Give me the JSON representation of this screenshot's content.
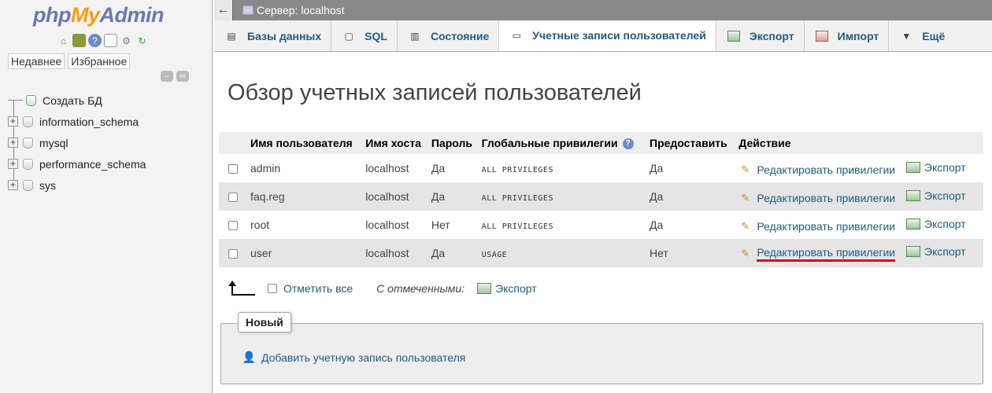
{
  "nav": {
    "logo_php": "php",
    "logo_my": "My",
    "logo_admin": "Admin",
    "icons": [
      "home-icon",
      "db-icon",
      "help-icon",
      "docs-icon",
      "settings-icon",
      "reload-icon"
    ],
    "tabs": [
      "Недавнее",
      "Избранное"
    ],
    "tree": [
      {
        "label": "Создать БД",
        "type": "new"
      },
      {
        "label": "information_schema",
        "type": "db"
      },
      {
        "label": "mysql",
        "type": "db"
      },
      {
        "label": "performance_schema",
        "type": "db"
      },
      {
        "label": "sys",
        "type": "db"
      }
    ]
  },
  "topbar": {
    "back": "←",
    "server": "Сервер: localhost"
  },
  "tabs": [
    {
      "label": "Базы данных",
      "icon": "database-icon"
    },
    {
      "label": "SQL",
      "icon": "sql-icon"
    },
    {
      "label": "Состояние",
      "icon": "status-icon"
    },
    {
      "label": "Учетные записи пользователей",
      "icon": "users-icon",
      "active": true
    },
    {
      "label": "Экспорт",
      "icon": "export-icon"
    },
    {
      "label": "Импорт",
      "icon": "import-icon"
    },
    {
      "label": "Ещё",
      "icon": "more-icon"
    }
  ],
  "page_title": "Обзор учетных записей пользователей",
  "table": {
    "headers": [
      "Имя пользователя",
      "Имя хоста",
      "Пароль",
      "Глобальные привилегии",
      "Предоставить",
      "Действие"
    ],
    "rows": [
      {
        "user": "admin",
        "host": "localhost",
        "password": "Да",
        "privileges": "ALL PRIVILEGES",
        "grant": "Да"
      },
      {
        "user": "faq.reg",
        "host": "localhost",
        "password": "Да",
        "privileges": "ALL PRIVILEGES",
        "grant": "Да"
      },
      {
        "user": "root",
        "host": "localhost",
        "password": "Нет",
        "privileges": "ALL PRIVILEGES",
        "grant": "Да"
      },
      {
        "user": "user",
        "host": "localhost",
        "password": "Да",
        "privileges": "USAGE",
        "grant": "Нет"
      }
    ],
    "edit_label": "Редактировать привилегии",
    "export_label": "Экспорт",
    "highlight_color": "#c8102e"
  },
  "bulk": {
    "check_all": "Отметить все",
    "with_selected": "С отмеченными:",
    "export": "Экспорт"
  },
  "new_section": {
    "legend": "Новый",
    "add_user": "Добавить учетную запись пользователя"
  }
}
